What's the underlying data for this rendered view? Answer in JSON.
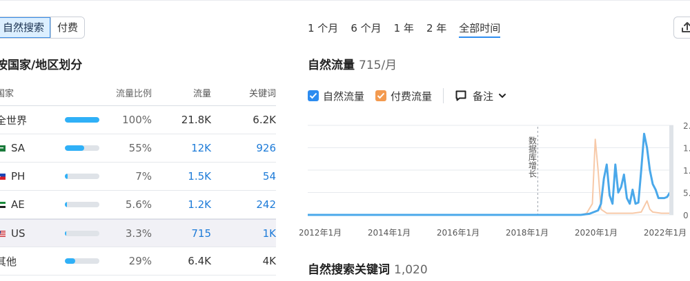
{
  "tabs": {
    "organic": "自然搜索",
    "paid": "付费"
  },
  "section_title": "按国家/地区划分",
  "table": {
    "headers": {
      "country": "国家",
      "share": "流量比例",
      "traffic": "流量",
      "keywords": "关键词"
    },
    "rows": [
      {
        "country": "全世界",
        "flag": "",
        "share_label": "100%",
        "share": 1.0,
        "traffic": "21.8K",
        "keywords": "6.2K",
        "link": false
      },
      {
        "country": "SA",
        "flag": "sa",
        "share_label": "55%",
        "share": 0.55,
        "traffic": "12K",
        "keywords": "926",
        "link": true
      },
      {
        "country": "PH",
        "flag": "ph",
        "share_label": "7%",
        "share": 0.07,
        "traffic": "1.5K",
        "keywords": "54",
        "link": true
      },
      {
        "country": "AE",
        "flag": "ae",
        "share_label": "5.6%",
        "share": 0.056,
        "traffic": "1.2K",
        "keywords": "242",
        "link": true
      },
      {
        "country": "US",
        "flag": "us",
        "share_label": "3.3%",
        "share": 0.033,
        "traffic": "715",
        "keywords": "1K",
        "link": true
      },
      {
        "country": "其他",
        "flag": "",
        "share_label": "29%",
        "share": 0.29,
        "traffic": "6.4K",
        "keywords": "4K",
        "link": false
      }
    ]
  },
  "periods": [
    "1 个月",
    "6 个月",
    "1 年",
    "2 年",
    "全部时间"
  ],
  "active_period": "全部时间",
  "traffic": {
    "title": "自然流量",
    "value": "715/月"
  },
  "legend": {
    "organic": "自然流量",
    "paid": "付费流量",
    "notes": "备注"
  },
  "keywords": {
    "title": "自然搜索关键词",
    "value": "1,020"
  },
  "colors": {
    "organic": "#4aa8ea",
    "paid": "#f7c9a8",
    "accent": "#2d8cf0",
    "bar": "#2fb0f7"
  },
  "chart_data": {
    "type": "line",
    "x_ticks": [
      "2012年1月",
      "2014年1月",
      "2016年1月",
      "2018年1月",
      "2020年1月",
      "2022年1月"
    ],
    "y_ticks": [
      "0",
      "5...",
      "1...",
      "1...",
      "2..."
    ],
    "annotation": "数据库增长",
    "annotation_x": "2018-09",
    "series": [
      {
        "name": "自然流量",
        "points": [
          [
            "2012-01",
            0
          ],
          [
            "2019-12",
            0
          ],
          [
            "2020-03",
            0.02
          ],
          [
            "2020-06",
            0.08
          ],
          [
            "2020-07",
            0.2
          ],
          [
            "2020-08",
            0.65
          ],
          [
            "2020-09",
            0.9
          ],
          [
            "2020-10",
            0.35
          ],
          [
            "2020-11",
            0.2
          ],
          [
            "2020-12",
            0.9
          ],
          [
            "2021-01",
            0.4
          ],
          [
            "2021-02",
            0.5
          ],
          [
            "2021-03",
            0.72
          ],
          [
            "2021-04",
            0.3
          ],
          [
            "2021-05",
            0.2
          ],
          [
            "2021-06",
            0.45
          ],
          [
            "2021-07",
            0.2
          ],
          [
            "2021-08",
            0.22
          ],
          [
            "2021-09",
            0.8
          ],
          [
            "2021-10",
            1.45
          ],
          [
            "2021-11",
            1.2
          ],
          [
            "2021-12",
            0.8
          ],
          [
            "2022-01",
            0.55
          ],
          [
            "2022-02",
            0.45
          ],
          [
            "2022-03",
            0.3
          ],
          [
            "2022-04",
            0.3
          ],
          [
            "2022-05",
            0.3
          ],
          [
            "2022-06",
            0.32
          ],
          [
            "2022-07",
            0.4
          ]
        ]
      },
      {
        "name": "付费流量",
        "points": [
          [
            "2012-01",
            0
          ],
          [
            "2019-12",
            0
          ],
          [
            "2020-02",
            0.03
          ],
          [
            "2020-04",
            0.2
          ],
          [
            "2020-05",
            1.35
          ],
          [
            "2020-06",
            0.8
          ],
          [
            "2020-07",
            0.1
          ],
          [
            "2020-09",
            0.03
          ],
          [
            "2021-06",
            0.03
          ],
          [
            "2021-09",
            0.05
          ],
          [
            "2021-11",
            0.25
          ],
          [
            "2021-12",
            0.1
          ],
          [
            "2022-01",
            0.05
          ],
          [
            "2022-04",
            0.03
          ],
          [
            "2022-07",
            0.03
          ]
        ]
      }
    ]
  }
}
